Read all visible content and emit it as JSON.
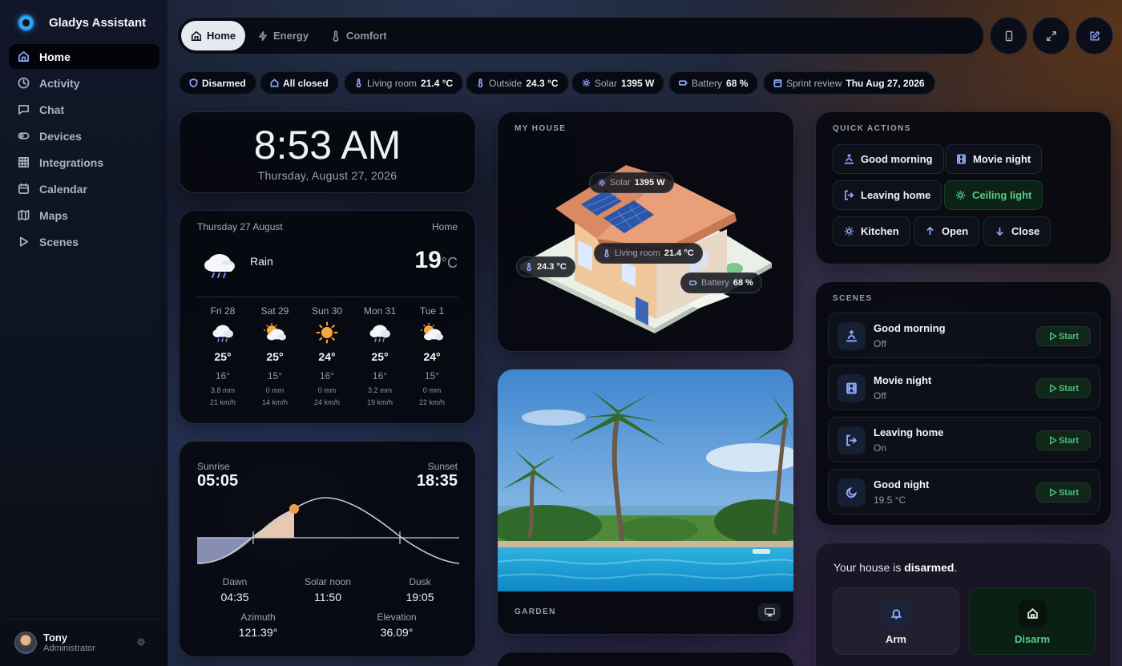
{
  "app": {
    "name": "Gladys Assistant"
  },
  "nav": [
    {
      "label": "Home",
      "icon": "home-icon",
      "active": true
    },
    {
      "label": "Activity",
      "icon": "clock-icon"
    },
    {
      "label": "Chat",
      "icon": "chat-icon"
    },
    {
      "label": "Devices",
      "icon": "toggle-icon"
    },
    {
      "label": "Integrations",
      "icon": "grid-icon"
    },
    {
      "label": "Calendar",
      "icon": "calendar-icon"
    },
    {
      "label": "Maps",
      "icon": "map-icon"
    },
    {
      "label": "Scenes",
      "icon": "play-icon"
    }
  ],
  "user": {
    "name": "Tony",
    "role": "Administrator"
  },
  "tabs": [
    {
      "label": "Home",
      "icon": "home-icon",
      "active": true
    },
    {
      "label": "Energy",
      "icon": "lightning-icon"
    },
    {
      "label": "Comfort",
      "icon": "thermometer-icon"
    }
  ],
  "status_chips": [
    {
      "label": "",
      "value": "Disarmed",
      "icon": "shield-icon"
    },
    {
      "label": "",
      "value": "All closed",
      "icon": "home-icon"
    },
    {
      "label": "Living room",
      "value": "21.4 °C",
      "icon": "thermometer-icon"
    },
    {
      "label": "Outside",
      "value": "24.3 °C",
      "icon": "thermometer-icon"
    },
    {
      "label": "Solar",
      "value": "1395 W",
      "icon": "sun-icon"
    },
    {
      "label": "Battery",
      "value": "68 %",
      "icon": "battery-icon"
    },
    {
      "label": "Sprint review",
      "value": "Thu Aug 27, 2026",
      "icon": "calendar-icon"
    }
  ],
  "clock": {
    "time": "8:53 AM",
    "date": "Thursday, August 27, 2026"
  },
  "weather": {
    "date": "Thursday 27 August",
    "location": "Home",
    "condition": "Rain",
    "temperature": "19",
    "unit": "°C",
    "forecast": [
      {
        "day": "Fri 28",
        "icon": "rain-cloud-icon",
        "high": "25°",
        "low": "16°",
        "precip": "3.8 mm",
        "wind": "21 km/h"
      },
      {
        "day": "Sat 29",
        "icon": "partly-sunny-icon",
        "high": "25°",
        "low": "15°",
        "precip": "0 mm",
        "wind": "14 km/h"
      },
      {
        "day": "Sun 30",
        "icon": "sun-icon",
        "high": "24°",
        "low": "16°",
        "precip": "0 mm",
        "wind": "24 km/h"
      },
      {
        "day": "Mon 31",
        "icon": "rain-cloud-icon",
        "high": "25°",
        "low": "16°",
        "precip": "3.2 mm",
        "wind": "19 km/h"
      },
      {
        "day": "Tue 1",
        "icon": "partly-sunny-icon",
        "high": "24°",
        "low": "15°",
        "precip": "0 mm",
        "wind": "22 km/h"
      }
    ]
  },
  "sun": {
    "sunrise_label": "Sunrise",
    "sunrise": "05:05",
    "sunset_label": "Sunset",
    "sunset": "18:35",
    "dawn_label": "Dawn",
    "dawn": "04:35",
    "noon_label": "Solar noon",
    "noon": "11:50",
    "dusk_label": "Dusk",
    "dusk": "19:05",
    "azimuth_label": "Azimuth",
    "azimuth": "121.39°",
    "elevation_label": "Elevation",
    "elevation": "36.09°"
  },
  "house": {
    "caption": "MY HOUSE",
    "badges": [
      {
        "label": "Solar",
        "value": "1395 W",
        "icon": "sun-icon"
      },
      {
        "label": "Living room",
        "value": "21.4 °C",
        "icon": "thermometer-icon"
      },
      {
        "label": "",
        "value": "24.3 °C",
        "icon": "thermometer-icon"
      },
      {
        "label": "Battery",
        "value": "68 %",
        "icon": "battery-icon"
      }
    ]
  },
  "garden": {
    "caption": "GARDEN"
  },
  "quick_actions": {
    "caption": "QUICK ACTIONS",
    "items": [
      {
        "label": "Good morning",
        "icon": "sunrise-icon"
      },
      {
        "label": "Movie night",
        "icon": "film-icon"
      },
      {
        "label": "Leaving home",
        "icon": "exit-icon"
      },
      {
        "label": "Ceiling light",
        "icon": "sun-icon",
        "state": "on"
      },
      {
        "label": "Kitchen",
        "icon": "sun-icon"
      },
      {
        "label": "Open",
        "icon": "arrow-up-icon"
      },
      {
        "label": "Close",
        "icon": "arrow-down-icon"
      }
    ]
  },
  "scenes": {
    "caption": "SCENES",
    "items": [
      {
        "name": "Good morning",
        "state": "Off",
        "icon": "sunrise-icon",
        "action": "Start"
      },
      {
        "name": "Movie night",
        "state": "Off",
        "icon": "film-icon",
        "action": "Start"
      },
      {
        "name": "Leaving home",
        "state": "On",
        "icon": "exit-icon",
        "action": "Start"
      },
      {
        "name": "Good night",
        "state": "19.5 °C",
        "icon": "moon-icon",
        "action": "Start"
      }
    ]
  },
  "alarm": {
    "text_prefix": "Your house is ",
    "state": "disarmed",
    "text_suffix": ".",
    "arm_label": "Arm",
    "disarm_label": "Disarm"
  },
  "colors": {
    "accent": "#8fa8ff",
    "active_green": "#59c988",
    "sun_marker": "#f0a04b"
  }
}
